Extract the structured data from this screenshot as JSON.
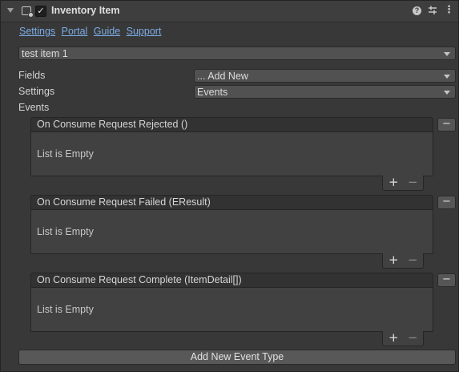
{
  "component": {
    "title": "Inventory Item",
    "enabled": true,
    "icons": [
      "foldout-arrow-icon",
      "script-icon",
      "help-icon",
      "preset-icon",
      "menu-icon"
    ]
  },
  "links": [
    "Settings",
    "Portal",
    "Guide",
    "Support"
  ],
  "item_select": {
    "value": "test item 1"
  },
  "fields": {
    "label": "Fields",
    "value": "... Add New"
  },
  "settings": {
    "label": "Settings",
    "value": "Events"
  },
  "events_label": "Events",
  "events": [
    {
      "title": "On Consume Request Rejected ()",
      "empty_text": "List is Empty",
      "add": "+",
      "remove": "−",
      "remove_button": "−"
    },
    {
      "title": "On Consume Request Failed (EResult)",
      "empty_text": "List is Empty",
      "add": "+",
      "remove": "−",
      "remove_button": "−"
    },
    {
      "title": "On Consume Request Complete (ItemDetail[])",
      "empty_text": "List is Empty",
      "add": "+",
      "remove": "−",
      "remove_button": "−"
    }
  ],
  "add_event_button": "Add New Event Type",
  "colors": {
    "background": "#383838",
    "header": "#3e3e3e",
    "link": "#7cace6",
    "dropdown": "#515151"
  }
}
